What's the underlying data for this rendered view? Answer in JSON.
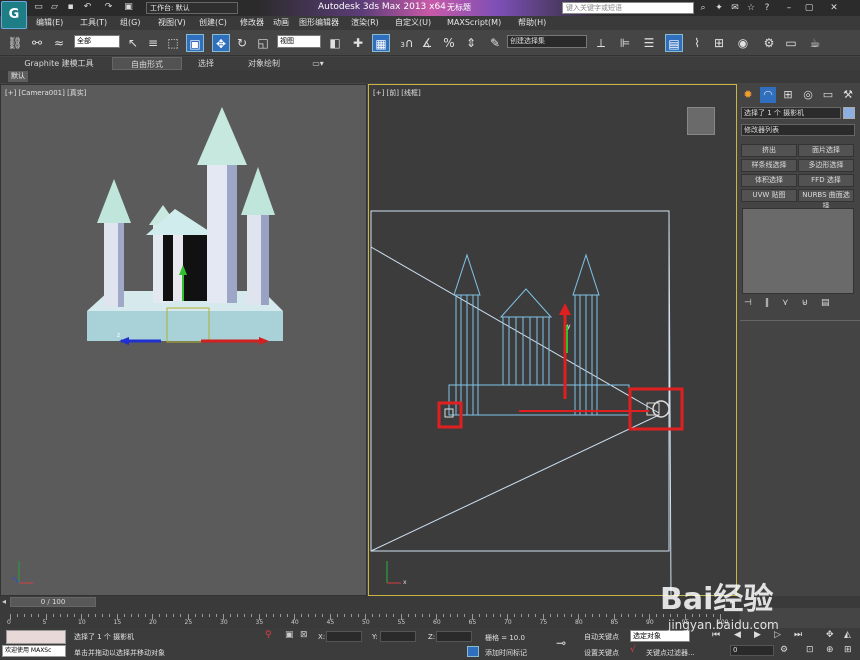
{
  "titlebar": {
    "workspace": "工作台: 默认",
    "app_title": "Autodesk 3ds Max  2013 x64",
    "doc_name": "无标题",
    "search_placeholder": "键入关键字或短语"
  },
  "menu": [
    "编辑(E)",
    "工具(T)",
    "组(G)",
    "视图(V)",
    "创建(C)",
    "修改器",
    "动画",
    "图形编辑器",
    "渲染(R)",
    "自定义(U)",
    "MAXScript(M)",
    "帮助(H)"
  ],
  "toolbar": {
    "filter": "全部",
    "coord": "视图",
    "selection_set": "创建选择集",
    "undo_count": "3"
  },
  "ribbon": {
    "tabs": [
      "Graphite 建模工具",
      "自由形式",
      "选择",
      "对象绘制"
    ],
    "sub_tab": "默认"
  },
  "viewports": {
    "left_label": "[+] [Camera001] [真实]",
    "right_label": "[+] [前] [线框]",
    "axis_x": "x",
    "axis_y": "y",
    "axis_z": "z"
  },
  "command_panel": {
    "selection_info": "选择了 1 个 摄影机",
    "modifier_list": "修改器列表",
    "buttons": [
      "挤出",
      "面片选择",
      "样条线选择",
      "多边形选择",
      "体积选择",
      "FFD 选择",
      "UVW 贴图",
      "NURBS 曲面选择"
    ]
  },
  "timeline": {
    "frame_display": "0 / 100",
    "tick_numbers": [
      "0",
      "5",
      "10",
      "15",
      "20",
      "25",
      "30",
      "35",
      "40",
      "45",
      "50",
      "55",
      "60",
      "65",
      "70",
      "75",
      "80",
      "85",
      "90",
      "95",
      "100"
    ]
  },
  "status": {
    "welcome": "欢迎使用 MAXSc",
    "selected": "选择了 1 个 摄影机",
    "prompt": "单击并拖动以选择并移动对象",
    "x_label": "X:",
    "y_label": "Y:",
    "z_label": "Z:",
    "grid": "栅格 = 10.0",
    "add_time_tag": "添加时间标记",
    "auto_key": "自动关键点",
    "set_key": "设置关键点",
    "selected_object": "选定对象",
    "key_filters": "关键点过滤器...",
    "frame_value": "0"
  },
  "watermark": {
    "brand": "Bai经验",
    "url": "jingyan.baidu.com"
  },
  "colors": {
    "viewport_border_active": "#c8b640",
    "selection_highlight": "#e02020",
    "auto_key_active": "#d8d8d8"
  }
}
